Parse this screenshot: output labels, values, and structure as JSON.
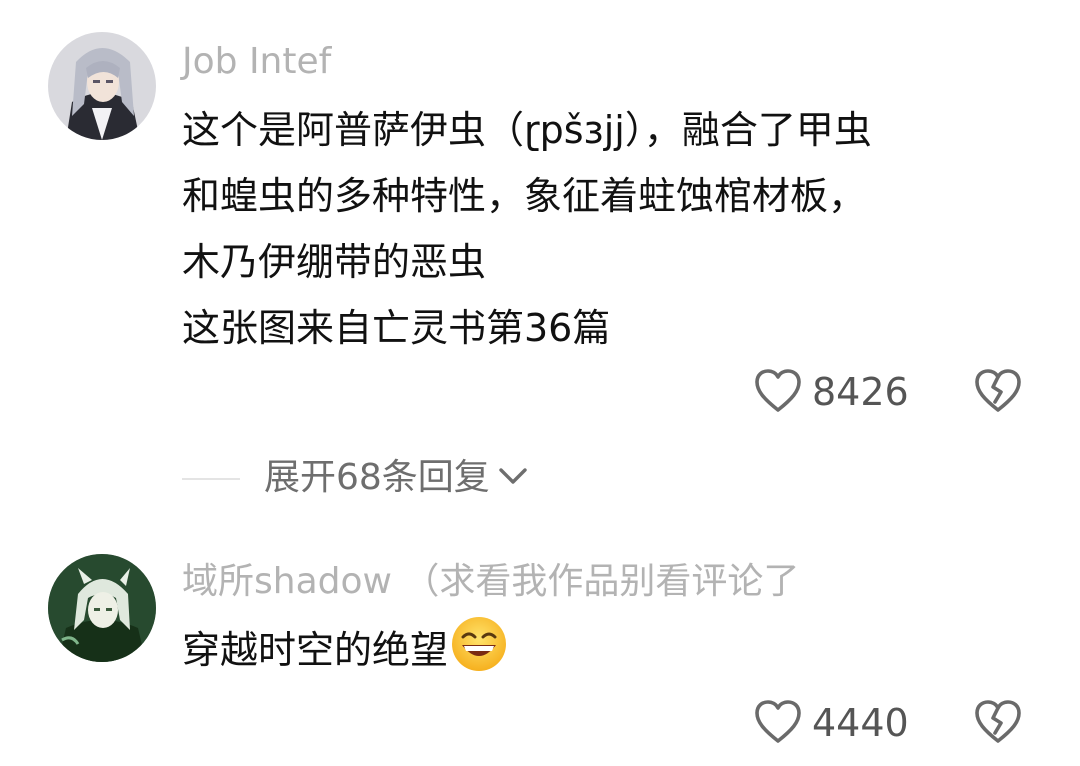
{
  "comments": [
    {
      "username": "Job Intef",
      "lines": [
        "这个是阿普萨伊虫（ɽpšɜjj），融合了甲虫",
        "和蝗虫的多种特性，象征着蛀蚀棺材板，",
        "木乃伊绷带的恶虫",
        "这张图来自亡灵书第36篇"
      ],
      "like_count": "8426",
      "avatar_icon": "anime-avatar-silver-hair",
      "like_icon": "heart-outline-icon",
      "dislike_icon": "broken-heart-icon"
    },
    {
      "username": "域所shadow （求看我作品别看评论了",
      "lines": [
        "穿越时空的绝望"
      ],
      "emoji": "grinning-squinting-face-emoji",
      "like_count": "4440",
      "avatar_icon": "anime-avatar-green-hair",
      "like_icon": "heart-outline-icon",
      "dislike_icon": "broken-heart-icon"
    }
  ],
  "replies": {
    "expand_label": "展开68条回复",
    "chevron_icon": "chevron-down-icon"
  },
  "colors": {
    "username": "#b3b3b3",
    "text": "#111111",
    "count": "#555555",
    "expand": "#6e6e6e",
    "icon": "#6a6a6a"
  }
}
